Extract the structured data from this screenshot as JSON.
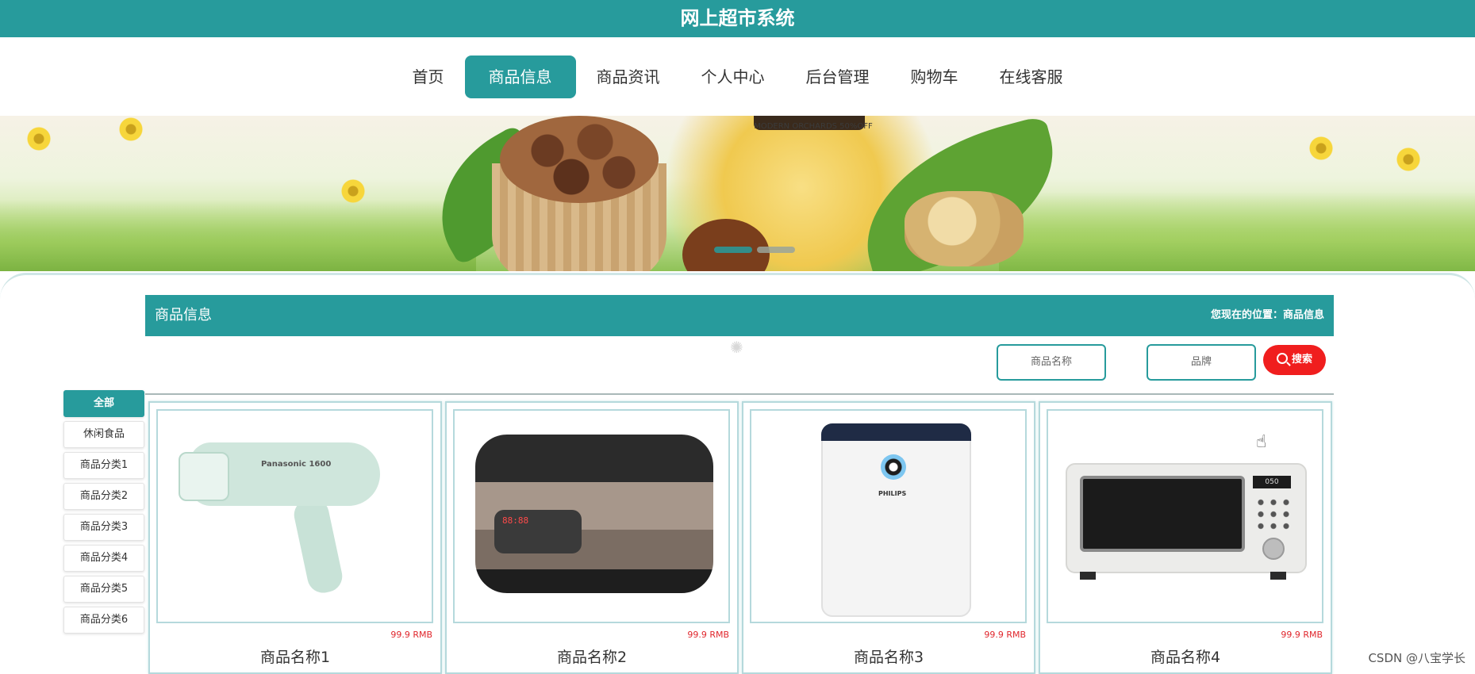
{
  "app": {
    "title": "网上超市系统"
  },
  "nav": {
    "items": [
      {
        "label": "首页",
        "active": false
      },
      {
        "label": "商品信息",
        "active": true
      },
      {
        "label": "商品资讯",
        "active": false
      },
      {
        "label": "个人中心",
        "active": false
      },
      {
        "label": "后台管理",
        "active": false
      },
      {
        "label": "购物车",
        "active": false
      },
      {
        "label": "在线客服",
        "active": false
      }
    ]
  },
  "banner": {
    "slogan": "MODERN ORCHARDS 50%OFF",
    "slides": 2,
    "active_slide": 1
  },
  "section": {
    "title": "商品信息",
    "location_label": "您现在的位置：",
    "location_value": "商品信息"
  },
  "search": {
    "name_placeholder": "商品名称",
    "brand_placeholder": "品牌",
    "button_label": "搜索"
  },
  "categories": [
    {
      "label": "全部",
      "active": true
    },
    {
      "label": "休闲食品",
      "active": false
    },
    {
      "label": "商品分类1",
      "active": false
    },
    {
      "label": "商品分类2",
      "active": false
    },
    {
      "label": "商品分类3",
      "active": false
    },
    {
      "label": "商品分类4",
      "active": false
    },
    {
      "label": "商品分类5",
      "active": false
    },
    {
      "label": "商品分类6",
      "active": false
    }
  ],
  "products": [
    {
      "name": "商品名称1",
      "price": "99.9 RMB",
      "image_icon": "hair-dryer-icon",
      "image_text": "Panasonic 1600"
    },
    {
      "name": "商品名称2",
      "price": "99.9 RMB",
      "image_icon": "rice-cooker-icon",
      "image_text": ""
    },
    {
      "name": "商品名称3",
      "price": "99.9 RMB",
      "image_icon": "air-purifier-icon",
      "image_text": "PHILIPS"
    },
    {
      "name": "商品名称4",
      "price": "99.9 RMB",
      "image_icon": "microwave-icon",
      "image_text": "050"
    }
  ],
  "watermark": "CSDN @八宝学长",
  "colors": {
    "accent": "#279b9c",
    "search_button": "#f01e1e",
    "price": "#e0262c"
  }
}
